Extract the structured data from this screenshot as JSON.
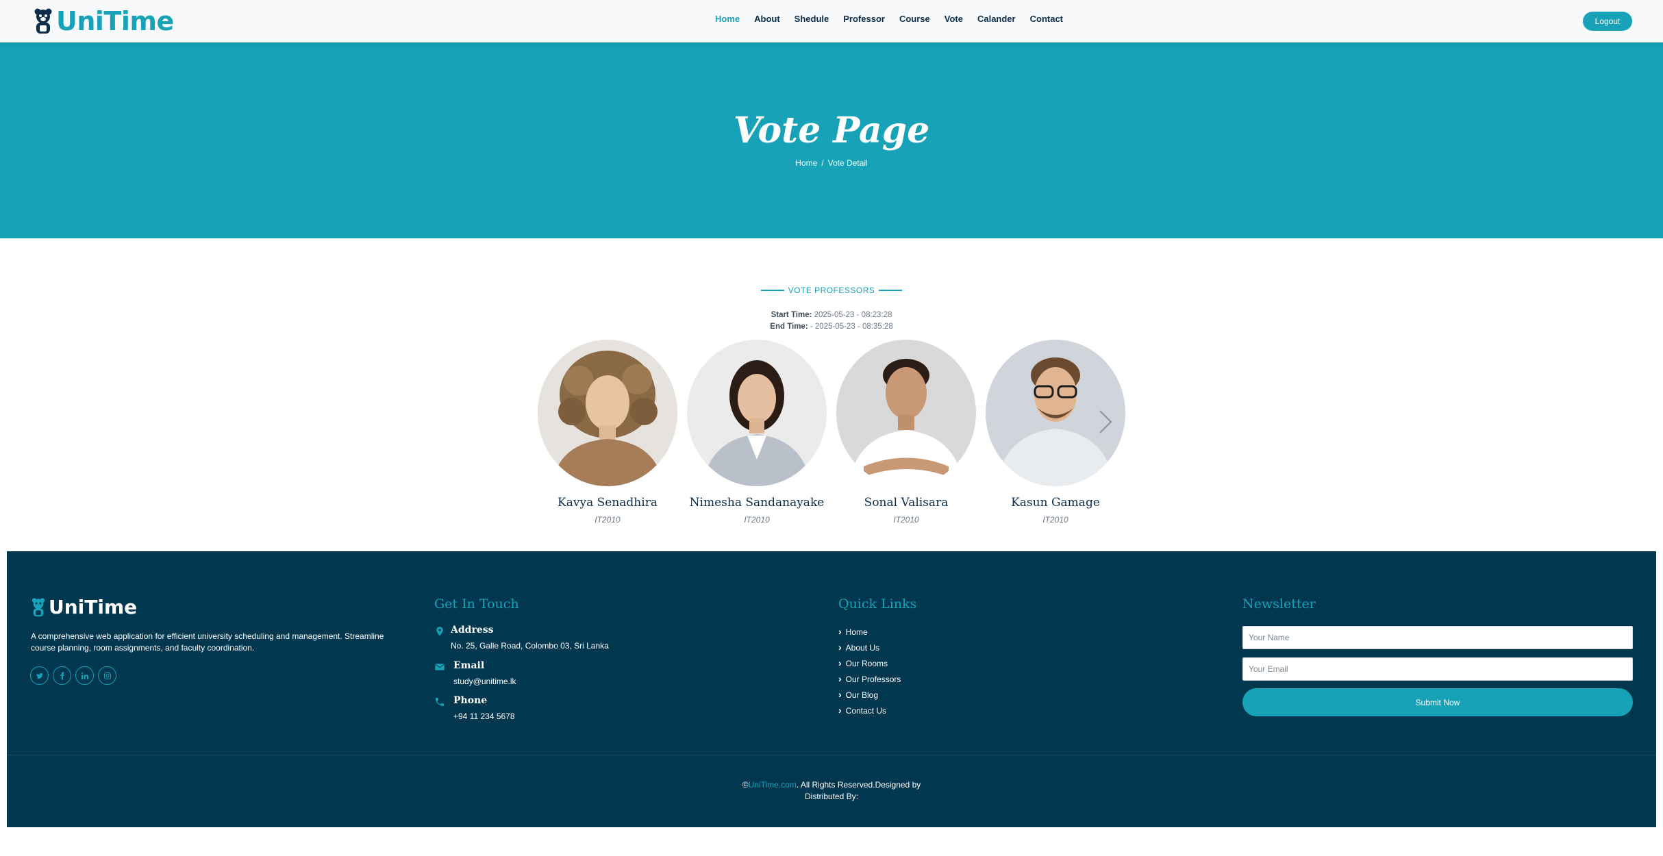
{
  "header": {
    "brand": "UniTime",
    "nav": [
      {
        "label": "Home",
        "active": true
      },
      {
        "label": "About"
      },
      {
        "label": "Shedule"
      },
      {
        "label": "Professor"
      },
      {
        "label": "Course"
      },
      {
        "label": "Vote"
      },
      {
        "label": "Calander"
      },
      {
        "label": "Contact"
      }
    ],
    "logout_label": "Logout"
  },
  "hero": {
    "title": "Vote Page",
    "breadcrumb": {
      "home": "Home",
      "separator": "/",
      "current": "Vote Detail"
    }
  },
  "vote": {
    "tag": "VOTE PROFESSORS",
    "start_label": "Start Time:",
    "start_value": "2025-05-23 - 08:23:28",
    "end_label": "End Time:",
    "end_value": "- 2025-05-23 - 08:35:28",
    "candidates": [
      {
        "name": "Kavya Senadhira",
        "code": "IT2010"
      },
      {
        "name": "Nimesha Sandanayake",
        "code": "IT2010"
      },
      {
        "name": "Sonal Valisara",
        "code": "IT2010"
      },
      {
        "name": "Kasun Gamage",
        "code": "IT2010"
      }
    ]
  },
  "footer": {
    "brand": "UniTime",
    "description": "A comprehensive web application for efficient university scheduling and management. Streamline course planning, room assignments, and faculty coordination.",
    "socials": [
      "twitter-icon",
      "facebook-icon",
      "linkedin-icon",
      "instagram-icon"
    ],
    "get_in_touch": {
      "title": "Get In Touch",
      "address_label": "Address",
      "address_value": "No. 25, Galle Road, Colombo 03, Sri Lanka",
      "email_label": "Email",
      "email_value": "study@unitime.lk",
      "phone_label": "Phone",
      "phone_value": "+94 11 234 5678"
    },
    "quick_links": {
      "title": "Quick Links",
      "items": [
        "Home",
        "About Us",
        "Our Rooms",
        "Our Professors",
        "Our Blog",
        "Contact Us"
      ]
    },
    "newsletter": {
      "title": "Newsletter",
      "name_placeholder": "Your Name",
      "email_placeholder": "Your Email",
      "submit_label": "Submit Now"
    },
    "copyright": {
      "prefix": "©",
      "site": "UniTime.com",
      "text": ". All Rights Reserved.Designed by",
      "distributed": "Distributed By:"
    }
  },
  "colors": {
    "accent": "#17a2b8",
    "footer_bg": "#023750",
    "text_dark": "#0b2d4a"
  }
}
